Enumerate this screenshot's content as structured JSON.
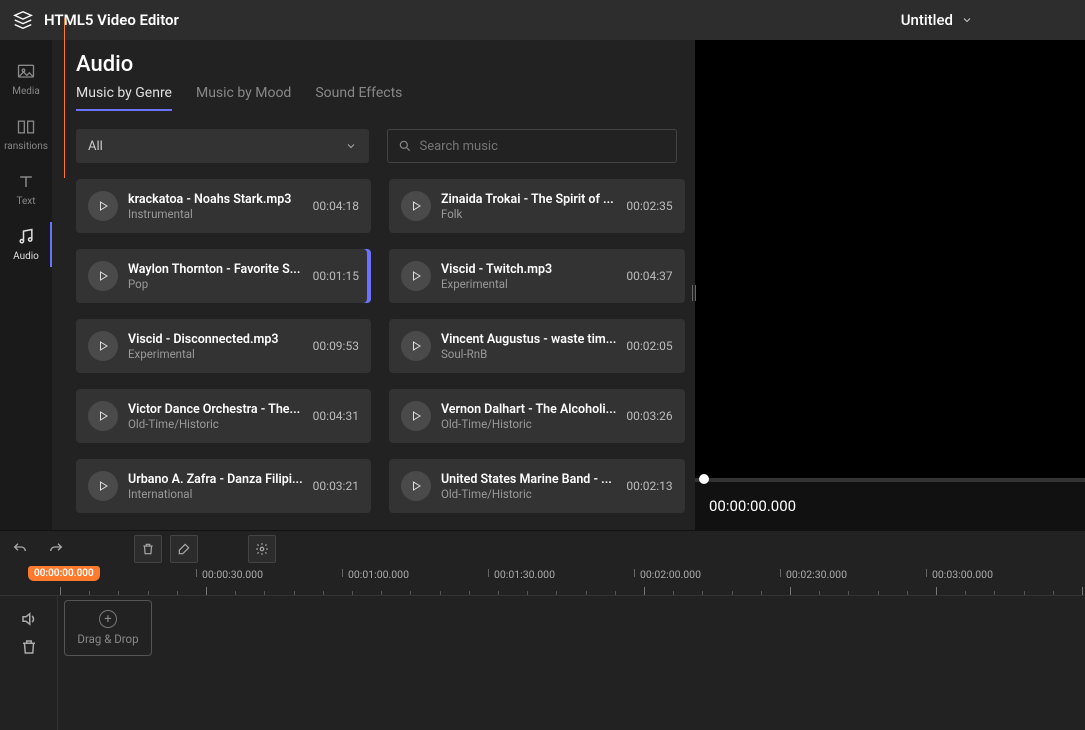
{
  "header": {
    "app_title": "HTML5 Video Editor",
    "project_name": "Untitled"
  },
  "sidebar": {
    "items": [
      {
        "label": "Media",
        "icon": "image-icon"
      },
      {
        "label": "ransitions",
        "icon": "transitions-icon"
      },
      {
        "label": "Text",
        "icon": "text-icon"
      },
      {
        "label": "Audio",
        "icon": "audio-icon"
      }
    ],
    "active_index": 3
  },
  "panel": {
    "title": "Audio",
    "tabs": [
      "Music by Genre",
      "Music by Mood",
      "Sound Effects"
    ],
    "active_tab": 0,
    "filter_label": "All",
    "search_placeholder": "Search music"
  },
  "tracks": [
    {
      "title": "krackatoa - Noahs Stark.mp3",
      "genre": "Instrumental",
      "duration": "00:04:18"
    },
    {
      "title": "Zinaida Trokai - The Spirit of ...",
      "genre": "Folk",
      "duration": "00:02:35"
    },
    {
      "title": "Waylon Thornton - Favorite S...",
      "genre": "Pop",
      "duration": "00:01:15",
      "active": true
    },
    {
      "title": "Viscid - Twitch.mp3",
      "genre": "Experimental",
      "duration": "00:04:37"
    },
    {
      "title": "Viscid - Disconnected.mp3",
      "genre": "Experimental",
      "duration": "00:09:53"
    },
    {
      "title": "Vincent Augustus - waste tim...",
      "genre": "Soul-RnB",
      "duration": "00:02:05"
    },
    {
      "title": "Victor Dance Orchestra - The...",
      "genre": "Old-Time/Historic",
      "duration": "00:04:31"
    },
    {
      "title": "Vernon Dalhart - The Alcoholi...",
      "genre": "Old-Time/Historic",
      "duration": "00:03:26"
    },
    {
      "title": "Urbano A. Zafra - Danza Filipi...",
      "genre": "International",
      "duration": "00:03:21"
    },
    {
      "title": "United States Marine Band - ...",
      "genre": "Old-Time/Historic",
      "duration": "00:02:13"
    }
  ],
  "preview": {
    "time": "00:00:00.000"
  },
  "timeline": {
    "playhead_label": "00:00:00.000",
    "labels": [
      "00:00:30.000",
      "00:01:00.000",
      "00:01:30.000",
      "00:02:00.000",
      "00:02:30.000",
      "00:03:00.000"
    ],
    "drop_label": "Drag & Drop"
  }
}
